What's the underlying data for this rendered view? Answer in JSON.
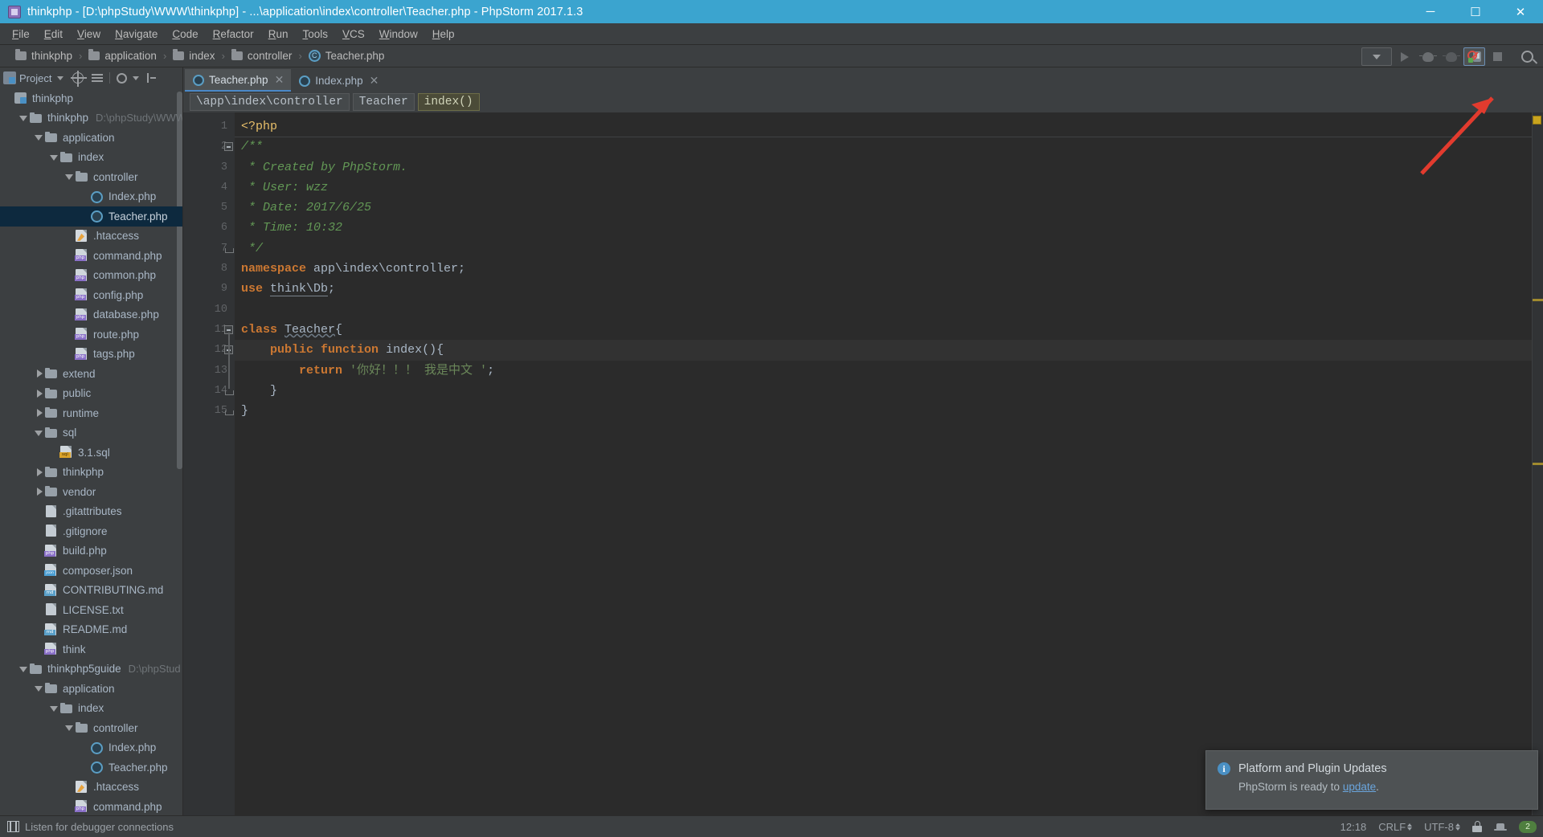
{
  "window": {
    "title": "thinkphp - [D:\\phpStudy\\WWW\\thinkphp] - ...\\application\\index\\controller\\Teacher.php - PhpStorm 2017.1.3",
    "minimize": "─",
    "maximize": "☐",
    "close": "✕",
    "accent": "#3ba4cf"
  },
  "menu": {
    "items": [
      "File",
      "Edit",
      "View",
      "Navigate",
      "Code",
      "Refactor",
      "Run",
      "Tools",
      "VCS",
      "Window",
      "Help"
    ]
  },
  "navbar": {
    "crumbs": [
      {
        "label": "thinkphp",
        "icon": "folder-icon"
      },
      {
        "label": "application",
        "icon": "folder-icon"
      },
      {
        "label": "index",
        "icon": "folder-icon"
      },
      {
        "label": "controller",
        "icon": "folder-icon"
      },
      {
        "label": "Teacher.php",
        "icon": "php-class-icon"
      }
    ],
    "separator": "›",
    "buttons": [
      {
        "name": "run-config-combo",
        "icon": "chevron-down-icon"
      },
      {
        "name": "run-button",
        "icon": "run-icon"
      },
      {
        "name": "debug-button",
        "icon": "bug-icon"
      },
      {
        "name": "run-with-coverage-button",
        "icon": "coverage-icon"
      },
      {
        "name": "listen-debug-connections-button",
        "icon": "listen-debug-icon"
      },
      {
        "name": "stop-button",
        "icon": "stop-icon"
      },
      {
        "name": "search-everywhere-button",
        "icon": "search-icon"
      }
    ]
  },
  "project_panel": {
    "title": "Project",
    "toolbar": [
      {
        "name": "project-view-icon",
        "icon": "project-icon"
      },
      {
        "name": "view-mode-dropdown",
        "icon": "chevron-down-icon"
      },
      {
        "name": "scroll-from-source-button",
        "icon": "target-icon"
      },
      {
        "name": "collapse-all-button",
        "icon": "collapse-icon"
      },
      {
        "name": "settings-button",
        "icon": "gear-icon"
      },
      {
        "name": "hide-panel-button",
        "icon": "hide-icon"
      }
    ],
    "tree": [
      {
        "depth": 0,
        "label": "thinkphp",
        "icon": "project-icon",
        "arrow": "none",
        "path": ""
      },
      {
        "depth": 1,
        "label": "thinkphp",
        "icon": "folder-icon",
        "arrow": "down",
        "path": "D:\\phpStudy\\WWW"
      },
      {
        "depth": 2,
        "label": "application",
        "icon": "folder-icon",
        "arrow": "down",
        "path": ""
      },
      {
        "depth": 3,
        "label": "index",
        "icon": "folder-icon",
        "arrow": "down",
        "path": ""
      },
      {
        "depth": 4,
        "label": "controller",
        "icon": "folder-icon",
        "arrow": "down",
        "path": ""
      },
      {
        "depth": 5,
        "label": "Index.php",
        "icon": "php-class-icon",
        "arrow": "none",
        "path": ""
      },
      {
        "depth": 5,
        "label": "Teacher.php",
        "icon": "php-class-icon",
        "arrow": "none",
        "path": "",
        "selected": true
      },
      {
        "depth": 4,
        "label": ".htaccess",
        "icon": "htaccess-icon",
        "arrow": "none",
        "path": ""
      },
      {
        "depth": 4,
        "label": "command.php",
        "icon": "php-file-icon",
        "arrow": "none",
        "path": ""
      },
      {
        "depth": 4,
        "label": "common.php",
        "icon": "php-file-icon",
        "arrow": "none",
        "path": ""
      },
      {
        "depth": 4,
        "label": "config.php",
        "icon": "php-file-icon",
        "arrow": "none",
        "path": ""
      },
      {
        "depth": 4,
        "label": "database.php",
        "icon": "php-file-icon",
        "arrow": "none",
        "path": ""
      },
      {
        "depth": 4,
        "label": "route.php",
        "icon": "php-file-icon",
        "arrow": "none",
        "path": ""
      },
      {
        "depth": 4,
        "label": "tags.php",
        "icon": "php-file-icon",
        "arrow": "none",
        "path": ""
      },
      {
        "depth": 2,
        "label": "extend",
        "icon": "folder-icon",
        "arrow": "right",
        "path": ""
      },
      {
        "depth": 2,
        "label": "public",
        "icon": "folder-icon",
        "arrow": "right",
        "path": ""
      },
      {
        "depth": 2,
        "label": "runtime",
        "icon": "folder-icon",
        "arrow": "right",
        "path": ""
      },
      {
        "depth": 2,
        "label": "sql",
        "icon": "folder-icon",
        "arrow": "down",
        "path": ""
      },
      {
        "depth": 3,
        "label": "3.1.sql",
        "icon": "sql-file-icon",
        "arrow": "none",
        "path": ""
      },
      {
        "depth": 2,
        "label": "thinkphp",
        "icon": "folder-icon",
        "arrow": "right",
        "path": ""
      },
      {
        "depth": 2,
        "label": "vendor",
        "icon": "folder-icon",
        "arrow": "right",
        "path": ""
      },
      {
        "depth": 2,
        "label": ".gitattributes",
        "icon": "text-file-icon",
        "arrow": "none",
        "path": ""
      },
      {
        "depth": 2,
        "label": ".gitignore",
        "icon": "text-file-icon",
        "arrow": "none",
        "path": ""
      },
      {
        "depth": 2,
        "label": "build.php",
        "icon": "php-file-icon",
        "arrow": "none",
        "path": ""
      },
      {
        "depth": 2,
        "label": "composer.json",
        "icon": "json-file-icon",
        "arrow": "none",
        "path": ""
      },
      {
        "depth": 2,
        "label": "CONTRIBUTING.md",
        "icon": "md-file-icon",
        "arrow": "none",
        "path": ""
      },
      {
        "depth": 2,
        "label": "LICENSE.txt",
        "icon": "text-file-icon",
        "arrow": "none",
        "path": ""
      },
      {
        "depth": 2,
        "label": "README.md",
        "icon": "md-file-icon",
        "arrow": "none",
        "path": ""
      },
      {
        "depth": 2,
        "label": "think",
        "icon": "php-file-icon",
        "arrow": "none",
        "path": ""
      },
      {
        "depth": 1,
        "label": "thinkphp5guide",
        "icon": "folder-icon",
        "arrow": "down",
        "path": "D:\\phpStud"
      },
      {
        "depth": 2,
        "label": "application",
        "icon": "folder-icon",
        "arrow": "down",
        "path": ""
      },
      {
        "depth": 3,
        "label": "index",
        "icon": "folder-icon",
        "arrow": "down",
        "path": ""
      },
      {
        "depth": 4,
        "label": "controller",
        "icon": "folder-icon",
        "arrow": "down",
        "path": ""
      },
      {
        "depth": 5,
        "label": "Index.php",
        "icon": "php-class-icon",
        "arrow": "none",
        "path": ""
      },
      {
        "depth": 5,
        "label": "Teacher.php",
        "icon": "php-class-icon",
        "arrow": "none",
        "path": ""
      },
      {
        "depth": 4,
        "label": ".htaccess",
        "icon": "htaccess-icon",
        "arrow": "none",
        "path": ""
      },
      {
        "depth": 4,
        "label": "command.php",
        "icon": "php-file-icon",
        "arrow": "none",
        "path": ""
      }
    ]
  },
  "editor": {
    "tabs": [
      {
        "label": "Teacher.php",
        "icon": "php-class-icon",
        "active": true,
        "close": "✕"
      },
      {
        "label": "Index.php",
        "icon": "php-class-icon",
        "active": false,
        "close": "✕"
      }
    ],
    "structure_breadcrumb": [
      {
        "label": "\\app\\index\\controller",
        "current": false
      },
      {
        "label": "Teacher",
        "current": false
      },
      {
        "label": "index()",
        "current": true
      }
    ],
    "line_numbers": [
      "1",
      "2",
      "3",
      "4",
      "5",
      "6",
      "7",
      "8",
      "9",
      "10",
      "11",
      "12",
      "13",
      "14",
      "15"
    ],
    "code_lines": [
      {
        "n": 1,
        "tokens": [
          {
            "t": "<?php",
            "c": "kp"
          }
        ]
      },
      {
        "n": 2,
        "tokens": [
          {
            "t": "/**",
            "c": "cm"
          }
        ]
      },
      {
        "n": 3,
        "tokens": [
          {
            "t": " * Created by PhpStorm.",
            "c": "cm"
          }
        ]
      },
      {
        "n": 4,
        "tokens": [
          {
            "t": " * User: wzz",
            "c": "cm"
          }
        ]
      },
      {
        "n": 5,
        "tokens": [
          {
            "t": " * Date: 2017/6/25",
            "c": "cm"
          }
        ]
      },
      {
        "n": 6,
        "tokens": [
          {
            "t": " * Time: 10:32",
            "c": "cm"
          }
        ]
      },
      {
        "n": 7,
        "tokens": [
          {
            "t": " */",
            "c": "cm"
          }
        ]
      },
      {
        "n": 8,
        "tokens": [
          {
            "t": "namespace",
            "c": "k"
          },
          {
            "t": " app\\index\\controller;",
            "c": "id"
          }
        ]
      },
      {
        "n": 9,
        "tokens": [
          {
            "t": "use",
            "c": "k"
          },
          {
            "t": " ",
            "c": "id"
          },
          {
            "t": "think\\Db",
            "c": "ul"
          },
          {
            "t": ";",
            "c": "id"
          }
        ]
      },
      {
        "n": 10,
        "tokens": []
      },
      {
        "n": 11,
        "tokens": [
          {
            "t": "class",
            "c": "k"
          },
          {
            "t": " ",
            "c": "id"
          },
          {
            "t": "Teacher",
            "c": "cls"
          },
          {
            "t": "{",
            "c": "id"
          }
        ]
      },
      {
        "n": 12,
        "tokens": [
          {
            "t": "    ",
            "c": "id"
          },
          {
            "t": "public function",
            "c": "k"
          },
          {
            "t": " ",
            "c": "id"
          },
          {
            "t": "index",
            "c": "id"
          },
          {
            "t": "(){",
            "c": "id"
          }
        ]
      },
      {
        "n": 13,
        "tokens": [
          {
            "t": "        ",
            "c": "id"
          },
          {
            "t": "return",
            "c": "k"
          },
          {
            "t": " ",
            "c": "id"
          },
          {
            "t": "'你好！！！ 我是中文 '",
            "c": "st"
          },
          {
            "t": ";",
            "c": "id"
          }
        ]
      },
      {
        "n": 14,
        "tokens": [
          {
            "t": "    }",
            "c": "id"
          }
        ]
      },
      {
        "n": 15,
        "tokens": [
          {
            "t": "}",
            "c": "id"
          }
        ]
      }
    ],
    "caret_line": 12
  },
  "notification": {
    "title": "Platform and Plugin Updates",
    "body_prefix": "PhpStorm is ready to ",
    "link": "update",
    "body_suffix": ".",
    "icon": "info-icon"
  },
  "statusbar": {
    "left_text": "Listen for debugger connections",
    "left_icon": "listen-debug-icon",
    "time": "12:18",
    "line_separator": "CRLF",
    "encoding": "UTF-8",
    "lock_icon": "lock-icon",
    "inspection_icon": "hector-icon",
    "memory": "2"
  }
}
